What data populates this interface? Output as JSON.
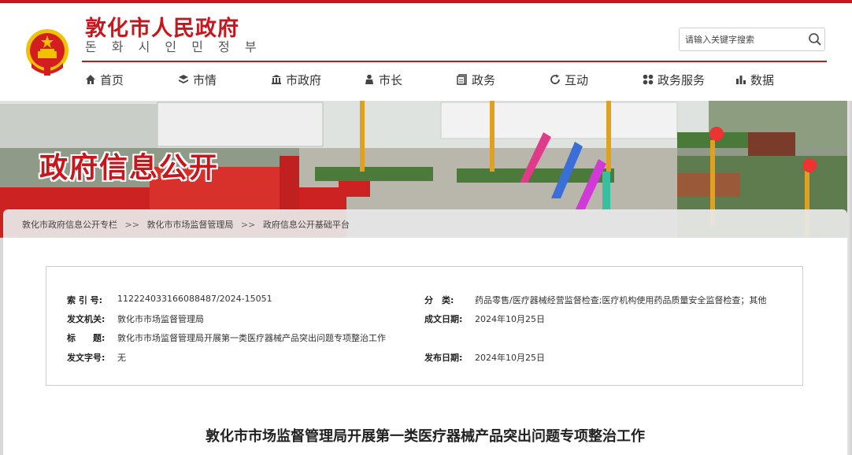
{
  "header": {
    "site_title": "敦化市人民政府",
    "site_subtitle": "돈 화 시 인 민 정 부",
    "search": {
      "placeholder": "请输入关键字搜索"
    }
  },
  "nav": {
    "items": [
      {
        "label": "首页",
        "icon": "home-icon"
      },
      {
        "label": "市情",
        "icon": "layers-icon"
      },
      {
        "label": "市政府",
        "icon": "government-building-icon"
      },
      {
        "label": "市长",
        "icon": "person-icon"
      },
      {
        "label": "政务",
        "icon": "document-icon"
      },
      {
        "label": "互动",
        "icon": "refresh-icon"
      },
      {
        "label": "政务服务",
        "icon": "grid-icon"
      },
      {
        "label": "数据",
        "icon": "bar-chart-icon"
      }
    ]
  },
  "banner": {
    "title": "政府信息公开"
  },
  "breadcrumb": {
    "items": [
      "敦化市政府信息公开专栏",
      "敦化市市场监督管理局",
      "政府信息公开基础平台"
    ],
    "separator": ">>"
  },
  "meta": {
    "index_label": "索 引 号:",
    "index_value": "112224033166088487/2024-15051",
    "category_label": "分　类:",
    "category_value": "药品零售/医疗器械经营监督检查;医疗机构使用药品质量安全监督检查；其他",
    "issuer_label": "发文机关:",
    "issuer_value": "敦化市市场监督管理局",
    "created_label": "成文日期:",
    "created_value": "2024年10月25日",
    "title_label": "标　　题:",
    "title_value": "敦化市市场监督管理局开展第一类医疗器械产品突出问题专项整治工作",
    "doc_no_label": "发文字号:",
    "doc_no_value": "无",
    "published_label": "发布日期:",
    "published_value": "2024年10月25日"
  },
  "article": {
    "title": "敦化市市场监督管理局开展第一类医疗器械产品突出问题专项整治工作"
  },
  "colors": {
    "brand_red": "#c8161d",
    "emblem_gold": "#f2c200"
  }
}
